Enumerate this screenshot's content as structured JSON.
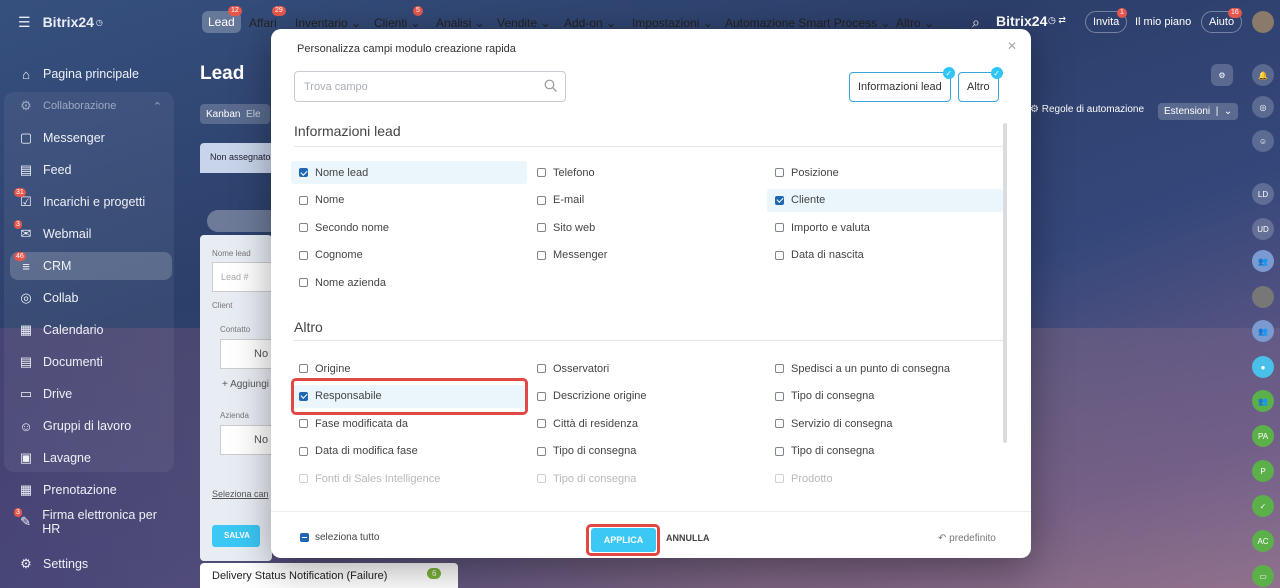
{
  "topbar": {
    "brand": "Bitrix24",
    "nav": [
      {
        "label": "Lead",
        "count": "12"
      },
      {
        "label": "Affari",
        "count": "29"
      },
      {
        "label": "Inventario ⌄"
      },
      {
        "label": "Clienti ⌄",
        "count": "5"
      },
      {
        "label": "Analisi ⌄"
      },
      {
        "label": "Vendite ⌄"
      },
      {
        "label": "Add-on ⌄"
      },
      {
        "label": "Impostazioni ⌄"
      },
      {
        "label": "Automazione Smart Process ⌄"
      },
      {
        "label": "Altro ⌄"
      }
    ],
    "brand_right": "Bitrix24",
    "invite": "Invita",
    "invite_count": "1",
    "my_plan": "Il mio piano",
    "help": "Aiuto",
    "help_count": "16"
  },
  "sidebar": {
    "items": [
      {
        "label": "Pagina principale",
        "icon": "home-icon"
      },
      {
        "label": "Collaborazione",
        "icon": "collab-icon"
      },
      {
        "label": "Messenger",
        "icon": "chat-icon"
      },
      {
        "label": "Feed",
        "icon": "feed-icon"
      },
      {
        "label": "Incarichi e progetti",
        "icon": "tasks-icon",
        "badge": "31"
      },
      {
        "label": "Webmail",
        "icon": "mail-icon",
        "badge": "3"
      },
      {
        "label": "CRM",
        "icon": "crm-icon",
        "badge": "46"
      },
      {
        "label": "Collab",
        "icon": "collab2-icon"
      },
      {
        "label": "Calendario",
        "icon": "calendar-icon"
      },
      {
        "label": "Documenti",
        "icon": "doc-icon"
      },
      {
        "label": "Drive",
        "icon": "drive-icon"
      },
      {
        "label": "Gruppi di lavoro",
        "icon": "group-icon"
      },
      {
        "label": "Lavagne",
        "icon": "board-icon"
      },
      {
        "label": "Prenotazione",
        "icon": "booking-icon"
      },
      {
        "label": "Firma elettronica per HR",
        "icon": "sign-icon",
        "badge": "3"
      },
      {
        "label": "Settings",
        "icon": "settings-icon"
      }
    ]
  },
  "page": {
    "title": "Lead",
    "kanban": "Kanban",
    "kanban_next": "Ele",
    "column": "Non assegnato",
    "card_field_lead_name": "Nome lead",
    "card_lead_placeholder": "Lead #",
    "card_client": "Client",
    "card_contact": "Contatto",
    "card_no": "No",
    "card_add": "+ Aggiungi",
    "card_company": "Azienda",
    "card_no2": "No",
    "card_select": "Seleziona can",
    "card_save": "SALVA",
    "delivery": "Delivery Status Notification (Failure)",
    "delivery_count": "6",
    "rules": "Regole di automazione",
    "extensions": "Estensioni"
  },
  "modal": {
    "title": "Personalizza campi modulo creazione rapida",
    "search_placeholder": "Trova campo",
    "tags": [
      "Informazioni lead",
      "Altro"
    ],
    "section1": "Informazioni lead",
    "section2": "Altro",
    "fields1": [
      {
        "label": "Nome lead",
        "checked": true
      },
      {
        "label": "Telefono",
        "checked": false
      },
      {
        "label": "Posizione",
        "checked": false
      },
      {
        "label": "Nome",
        "checked": false
      },
      {
        "label": "E-mail",
        "checked": false
      },
      {
        "label": "Cliente",
        "checked": true
      },
      {
        "label": "Secondo nome",
        "checked": false
      },
      {
        "label": "Sito web",
        "checked": false
      },
      {
        "label": "Importo e valuta",
        "checked": false
      },
      {
        "label": "Cognome",
        "checked": false
      },
      {
        "label": "Messenger",
        "checked": false
      },
      {
        "label": "Data di nascita",
        "checked": false
      },
      {
        "label": "Nome azienda",
        "checked": false
      }
    ],
    "fields2": [
      {
        "label": "Origine",
        "checked": false
      },
      {
        "label": "Osservatori",
        "checked": false
      },
      {
        "label": "Spedisci a un punto di consegna",
        "checked": false
      },
      {
        "label": "Responsabile",
        "checked": true
      },
      {
        "label": "Descrizione origine",
        "checked": false
      },
      {
        "label": "Tipo di consegna",
        "checked": false
      },
      {
        "label": "Fase modificata da",
        "checked": false
      },
      {
        "label": "Città di residenza",
        "checked": false
      },
      {
        "label": "Servizio di consegna",
        "checked": false
      },
      {
        "label": "Data di modifica fase",
        "checked": false
      },
      {
        "label": "Tipo di consegna",
        "checked": false
      },
      {
        "label": "Tipo di consegna",
        "checked": false
      },
      {
        "label": "Fonti di Sales Intelligence",
        "checked": false
      },
      {
        "label": "Tipo di consegna",
        "checked": false
      },
      {
        "label": "Prodotto",
        "checked": false
      }
    ],
    "select_all": "seleziona tutto",
    "apply": "APPLICA",
    "cancel": "ANNULLA",
    "default": "predefinito"
  },
  "rail": [
    "LD",
    "UD",
    "PA",
    "P",
    "AC"
  ],
  "colors": {
    "accent": "#3bc8f5",
    "highlight": "#e04848",
    "checkbox": "#2067b0"
  }
}
